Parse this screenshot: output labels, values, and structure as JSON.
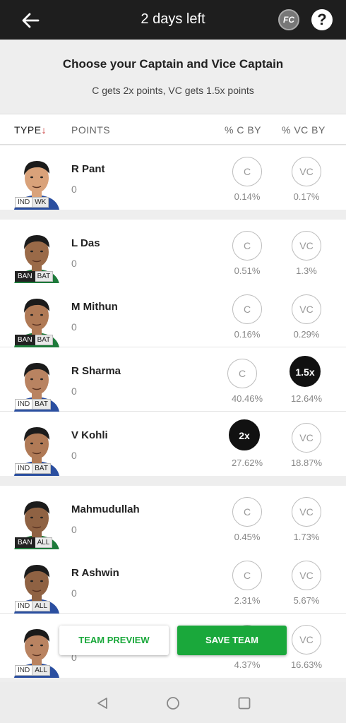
{
  "header": {
    "title": "2 days left",
    "fc_badge": "FC",
    "help_label": "?"
  },
  "intro": {
    "heading": "Choose your Captain and Vice Captain",
    "subheading": "C gets 2x points, VC gets 1.5x points"
  },
  "columns": {
    "type": "TYPE",
    "type_arrow": "↓",
    "points": "POINTS",
    "c_by": "% C BY",
    "vc_by": "% VC BY"
  },
  "players": [
    {
      "name": "R Pant",
      "points": "0",
      "team": "IND",
      "role": "WK",
      "c_label": "C",
      "vc_label": "VC",
      "c_pct": "0.14%",
      "vc_pct": "0.17%",
      "jersey": "#2b4fa0",
      "skin": "#d9a27a"
    },
    {
      "name": "L Das",
      "points": "0",
      "team": "BAN",
      "role": "BAT",
      "c_label": "C",
      "vc_label": "VC",
      "c_pct": "0.51%",
      "vc_pct": "1.3%",
      "jersey": "#1d7a3a",
      "skin": "#9a6a48"
    },
    {
      "name": "M Mithun",
      "points": "0",
      "team": "BAN",
      "role": "BAT",
      "c_label": "C",
      "vc_label": "VC",
      "c_pct": "0.16%",
      "vc_pct": "0.29%",
      "jersey": "#1d7a3a",
      "skin": "#b07a56"
    },
    {
      "name": "R Sharma",
      "points": "0",
      "team": "IND",
      "role": "BAT",
      "c_label": "C",
      "vc_label": "1.5x",
      "c_pct": "40.46%",
      "vc_pct": "12.64%",
      "jersey": "#2b4fa0",
      "skin": "#b98361"
    },
    {
      "name": "V Kohli",
      "points": "0",
      "team": "IND",
      "role": "BAT",
      "c_label": "2x",
      "vc_label": "VC",
      "c_pct": "27.62%",
      "vc_pct": "18.87%",
      "jersey": "#2b4fa0",
      "skin": "#b07a56"
    },
    {
      "name": "Mahmudullah",
      "points": "0",
      "team": "BAN",
      "role": "ALL",
      "c_label": "C",
      "vc_label": "VC",
      "c_pct": "0.45%",
      "vc_pct": "1.73%",
      "jersey": "#1d7a3a",
      "skin": "#8f6243"
    },
    {
      "name": "R Ashwin",
      "points": "0",
      "team": "IND",
      "role": "ALL",
      "c_label": "C",
      "vc_label": "VC",
      "c_pct": "2.31%",
      "vc_pct": "5.67%",
      "jersey": "#2b4fa0",
      "skin": "#8f6243"
    },
    {
      "name": "",
      "points": "0",
      "team": "IND",
      "role": "ALL",
      "c_label": "C",
      "vc_label": "VC",
      "c_pct": "4.37%",
      "vc_pct": "16.63%",
      "jersey": "#2b4fa0",
      "skin": "#b98361"
    }
  ],
  "actions": {
    "preview": "TEAM PREVIEW",
    "save": "SAVE TEAM"
  }
}
